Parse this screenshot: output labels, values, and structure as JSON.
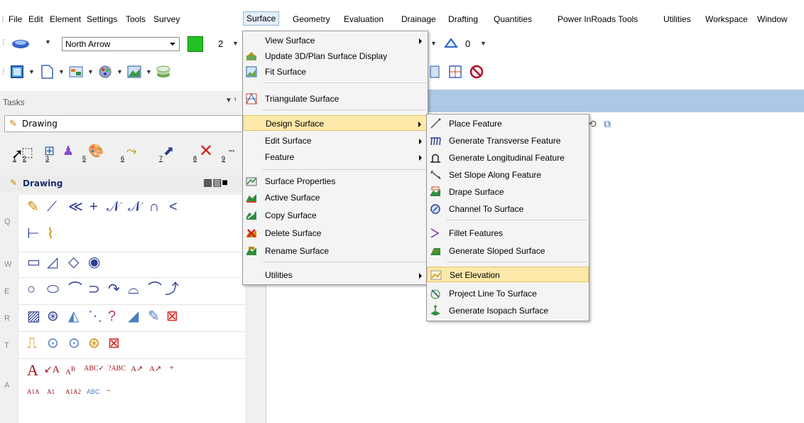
{
  "menubar": {
    "items": [
      "File",
      "Edit",
      "Element",
      "Settings",
      "Tools",
      "Survey",
      "Surface",
      "Geometry",
      "Evaluation",
      "Drainage",
      "Drafting",
      "Quantities",
      "Power InRoads Tools",
      "Utilities",
      "Workspace",
      "Window"
    ],
    "active": "Surface"
  },
  "toolbar": {
    "element_template": "North Arrow",
    "color_value": "2",
    "level_value": "0",
    "color_swatch": "#22c322"
  },
  "tasks": {
    "header": "Tasks",
    "dropdown_value": "Drawing",
    "panel_title": "Drawing",
    "numbered_tools": [
      "1",
      "2",
      "3",
      "4",
      "5",
      "6",
      "7",
      "8",
      "9"
    ],
    "row_labels": [
      "Q",
      "W",
      "E",
      "R",
      "T",
      "A"
    ]
  },
  "surface_menu": {
    "items": [
      {
        "label": "View Surface",
        "icon": "view-surface-icon",
        "submenu": true
      },
      {
        "label": "Update 3D/Plan Surface Display",
        "icon": "update-display-icon",
        "submenu": false
      },
      {
        "label": "Fit Surface",
        "icon": "fit-surface-icon",
        "submenu": false
      },
      {
        "label": "Triangulate Surface",
        "icon": "triangulate-icon",
        "submenu": false
      },
      {
        "label": "Design Surface",
        "icon": "",
        "submenu": true
      },
      {
        "label": "Edit Surface",
        "icon": "",
        "submenu": true
      },
      {
        "label": "Feature",
        "icon": "",
        "submenu": true
      },
      {
        "label": "Surface Properties",
        "icon": "surface-properties-icon",
        "submenu": false
      },
      {
        "label": "Active Surface",
        "icon": "active-surface-icon",
        "submenu": false
      },
      {
        "label": "Copy Surface",
        "icon": "copy-surface-icon",
        "submenu": false
      },
      {
        "label": "Delete Surface",
        "icon": "delete-surface-icon",
        "submenu": false
      },
      {
        "label": "Rename Surface",
        "icon": "rename-surface-icon",
        "submenu": false
      },
      {
        "label": "Utilities",
        "icon": "",
        "submenu": true
      }
    ],
    "highlighted": "Design Surface"
  },
  "design_submenu": {
    "items": [
      {
        "label": "Place Feature",
        "icon": "place-feature-icon"
      },
      {
        "label": "Generate Transverse Feature",
        "icon": "transverse-feature-icon"
      },
      {
        "label": "Generate Longitudinal Feature",
        "icon": "longitudinal-feature-icon"
      },
      {
        "label": "Set Slope Along Feature",
        "icon": "slope-feature-icon"
      },
      {
        "label": "Drape Surface",
        "icon": "drape-surface-icon"
      },
      {
        "label": "Channel To Surface",
        "icon": "channel-surface-icon"
      },
      {
        "label": "Fillet Features",
        "icon": "fillet-features-icon"
      },
      {
        "label": "Generate Sloped Surface",
        "icon": "sloped-surface-icon"
      },
      {
        "label": "Set Elevation",
        "icon": "set-elevation-icon"
      },
      {
        "label": "Project Line To Surface",
        "icon": "project-line-icon"
      },
      {
        "label": "Generate Isopach Surface",
        "icon": "isopach-surface-icon"
      }
    ],
    "highlighted": "Set Elevation"
  },
  "colors": {
    "highlight_bg": "#fde9a9",
    "highlight_border": "#e5c365",
    "title_band": "#adc8e6"
  }
}
